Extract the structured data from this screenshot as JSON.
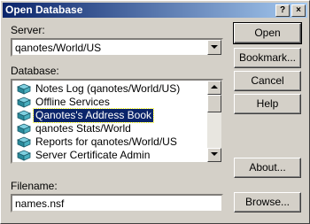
{
  "window": {
    "title": "Open Database",
    "help_glyph": "?",
    "close_glyph": "×"
  },
  "server": {
    "label": "Server:",
    "value": "qanotes/World/US"
  },
  "database": {
    "label": "Database:",
    "items": [
      {
        "label": "Notes Log (qanotes/World/US)",
        "icon": "database-icon",
        "selected": false
      },
      {
        "label": "Offline Services",
        "icon": "database-icon",
        "selected": false
      },
      {
        "label": "Qanotes's Address Book",
        "icon": "database-icon",
        "selected": true
      },
      {
        "label": "qanotes Stats/World",
        "icon": "database-icon",
        "selected": false
      },
      {
        "label": "Reports for qanotes/World/US",
        "icon": "database-icon",
        "selected": false
      },
      {
        "label": "Server Certificate Admin",
        "icon": "database-icon",
        "selected": false
      }
    ]
  },
  "filename": {
    "label": "Filename:",
    "value": "names.nsf"
  },
  "buttons": {
    "open": "Open",
    "bookmark": "Bookmark...",
    "cancel": "Cancel",
    "help": "Help",
    "about": "About...",
    "browse": "Browse..."
  },
  "colors": {
    "title_start": "#0a246a",
    "title_end": "#a6caf0",
    "selection": "#0a246a",
    "face": "#d4d0c8"
  }
}
